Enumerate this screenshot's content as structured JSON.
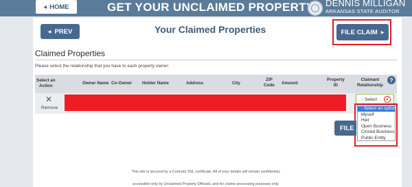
{
  "header": {
    "home_label": "HOME",
    "title": "GET YOUR UNCLAIMED PROPERTY",
    "auditor_name": "DENNIS MILLIGAN",
    "auditor_office": "ARKANSAS STATE AUDITOR"
  },
  "toolbar": {
    "prev_label": "PREV",
    "page_title": "Your Claimed Properties",
    "file_claim_label": "FILE CLAIM"
  },
  "section": {
    "title": "Claimed Properties",
    "instructions": "Please select the relationship that you have to each property owner:"
  },
  "table": {
    "columns": {
      "select_action": [
        "Select an",
        "Action"
      ],
      "owner_name": "Owner Name",
      "co_owner": "Co-Owner",
      "holder_name": "Holder Name",
      "address": "Address",
      "city": "City",
      "zip_code": [
        "ZIP",
        "Code"
      ],
      "amount": "Amount",
      "property_id": [
        "Property",
        "ID"
      ],
      "claimant_relationship": [
        "Claimant",
        "Relationship"
      ]
    },
    "help_icon": "?",
    "row": {
      "remove_label": "Remove",
      "select_value": "- Select"
    }
  },
  "relationship_options": [
    "- Select an option",
    "Myself",
    "Heir",
    "Open Business",
    "Closed Business",
    "Public Entity"
  ],
  "bottom_button_label": "FILE",
  "footer": {
    "line1": "This site is secured by a Comodo SSL certificate. All of your details will remain confidential,",
    "line2": "accessible only by Unclaimed Property Officials, and for claims processing purposes only."
  },
  "colors": {
    "header_bg": "#5b7b9a",
    "button_bg": "#48698f",
    "highlight_outline": "#e31b23",
    "redaction": "#ef1c24",
    "dropdown_selected": "#3b77d6"
  }
}
